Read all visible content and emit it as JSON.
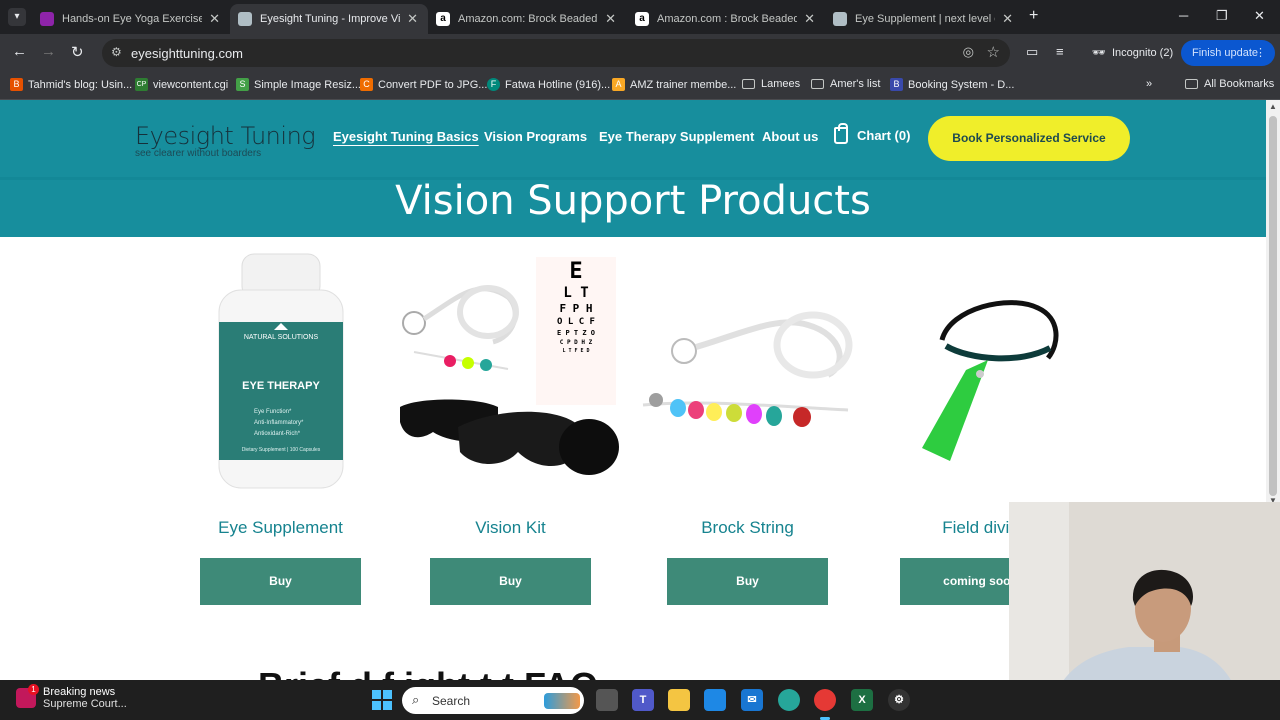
{
  "browser": {
    "tabs": [
      {
        "title": "Hands-on Eye Yoga Exercises to",
        "favicon_color": "#8e24aa",
        "active": false
      },
      {
        "title": "Eyesight Tuning - Improve Visio",
        "favicon_color": "#b0bec5",
        "active": true
      },
      {
        "title": "Amazon.com: Brock Beaded Str",
        "favicon_color": "#ffffff",
        "active": false
      },
      {
        "title": "Amazon.com : Brock Beaded St",
        "favicon_color": "#ffffff",
        "active": false
      },
      {
        "title": "Eye Supplement | next level eye",
        "favicon_color": "#b0bec5",
        "active": false
      }
    ],
    "url": "eyesighttuning.com",
    "incognito_label": "Incognito (2)",
    "finish_update_label": "Finish update",
    "bookmarks": [
      {
        "label": "Tahmid's blog: Usin...",
        "color": "#e65100",
        "glyph": "B"
      },
      {
        "label": "viewcontent.cgi",
        "color": "#2e7d32",
        "glyph": "CP"
      },
      {
        "label": "Simple Image Resiz...",
        "color": "#43a047",
        "glyph": "S"
      },
      {
        "label": "Convert PDF to JPG...",
        "color": "#ef6c00",
        "glyph": "C"
      },
      {
        "label": "Fatwa Hotline (916)...",
        "color": "#00897b",
        "glyph": "F"
      },
      {
        "label": "AMZ trainer membe...",
        "color": "#f9a825",
        "glyph": "A"
      },
      {
        "label": "Lamees",
        "folder": true
      },
      {
        "label": "Amer's list",
        "folder": true
      },
      {
        "label": "Booking System - D...",
        "color": "#3949ab",
        "glyph": "B"
      }
    ],
    "all_bookmarks_label": "All Bookmarks"
  },
  "site": {
    "logo_title": "Eyesight Tuning",
    "logo_tagline": "see clearer without boarders",
    "nav": [
      "Eyesight Tuning Basics",
      "Vision Programs",
      "Eye Therapy Supplement",
      "About us"
    ],
    "cart_label": "Chart (0)",
    "book_button": "Book Personalized Service",
    "section_title": "Vision Support Products",
    "bottle_brand": "NATURAL SOLUTIONS",
    "bottle_label": "EYE THERAPY",
    "bottle_bullets": [
      "Eye Function*",
      "Anti-Inflammatory*",
      "Antioxidant-Rich*"
    ],
    "bottle_footer": "Dietary Supplement | 100 Capsules",
    "eye_chart_rows": [
      "E",
      "L T",
      "F P H",
      "O L C F",
      "E P T Z O",
      "C P D H Z",
      "L T F E D"
    ],
    "products": [
      {
        "name": "Eye Supplement",
        "button": "Buy"
      },
      {
        "name": "Vision Kit",
        "button": "Buy"
      },
      {
        "name": "Brock String",
        "button": "Buy"
      },
      {
        "name": "Field divid",
        "button": "coming soon"
      }
    ],
    "faq_partial": "Brief d       f     ight t           t FAQ"
  },
  "taskbar": {
    "news_title": "Breaking news",
    "news_subtitle": "Supreme Court...",
    "news_badge": "1",
    "search_placeholder": "Search"
  }
}
